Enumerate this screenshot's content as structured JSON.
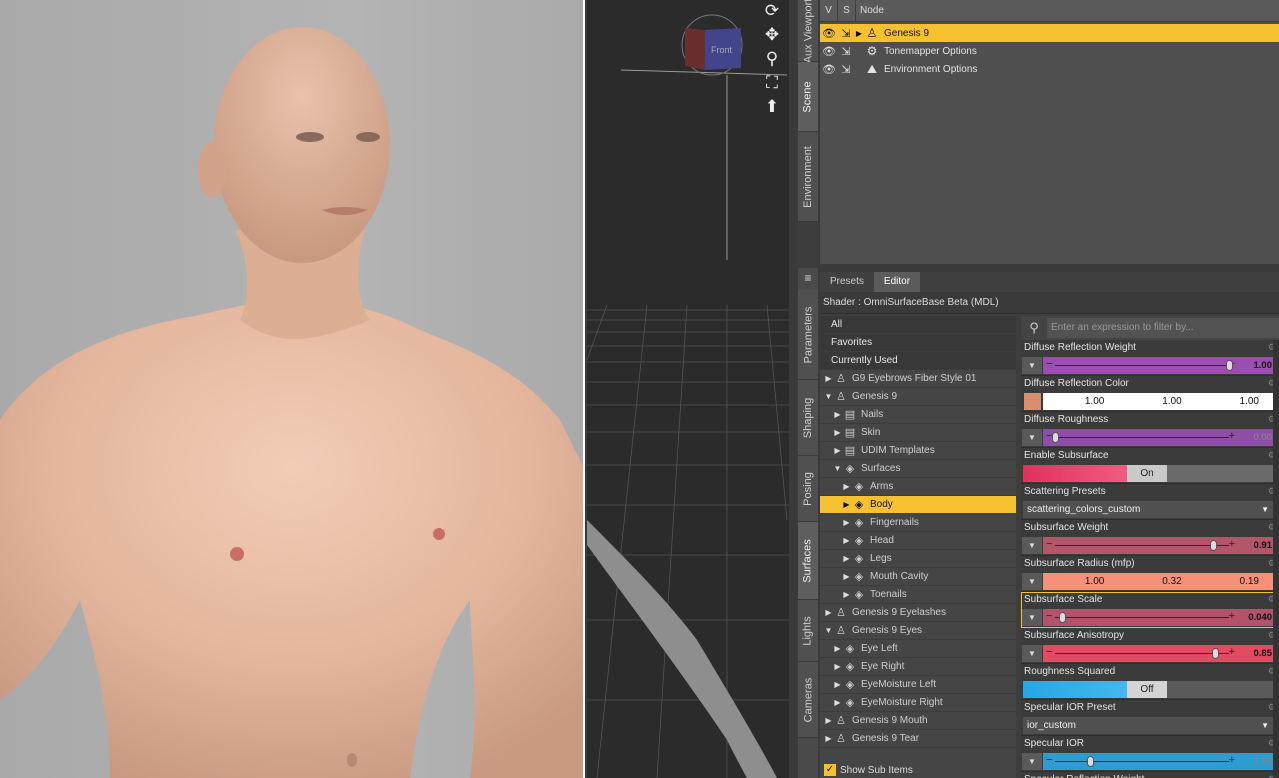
{
  "scene": {
    "columns": [
      "V",
      "S",
      "Node"
    ],
    "rows": [
      {
        "label": "Genesis 9",
        "selected": true
      },
      {
        "label": "Tonemapper Options",
        "selected": false
      },
      {
        "label": "Environment Options",
        "selected": false
      }
    ]
  },
  "side_tabs_top": [
    "Aux Viewport",
    "Scene",
    "Environment"
  ],
  "side_tabs_bottom": [
    "Parameters",
    "Shaping",
    "Posing",
    "Surfaces",
    "Lights",
    "Cameras"
  ],
  "viewport": {
    "cube_label": "Front",
    "tool_icons": [
      "orbit-icon",
      "move-icon",
      "zoom-icon",
      "frame-icon",
      "up-arrow-icon"
    ]
  },
  "surfaces": {
    "tabs": [
      "Presets",
      "Editor"
    ],
    "active_tab": "Editor",
    "shader": "Shader :  OmniSurfaceBase Beta (MDL)",
    "show_sub_items": "Show Sub Items",
    "tree": [
      {
        "label": "All",
        "type": "plain"
      },
      {
        "label": "Favorites",
        "type": "plain"
      },
      {
        "label": "Currently Used",
        "type": "plain"
      },
      {
        "label": "G9 Eyebrows Fiber Style 01",
        "type": "figure",
        "level": 0,
        "open": false
      },
      {
        "label": "Genesis 9",
        "type": "figure",
        "level": 0,
        "open": true
      },
      {
        "label": "Nails",
        "type": "group",
        "level": 1,
        "open": false
      },
      {
        "label": "Skin",
        "type": "group",
        "level": 1,
        "open": false
      },
      {
        "label": "UDIM Templates",
        "type": "group",
        "level": 1,
        "open": false
      },
      {
        "label": "Surfaces",
        "type": "surfaces",
        "level": 1,
        "open": true
      },
      {
        "label": "Arms",
        "type": "mat",
        "level": 2,
        "open": false
      },
      {
        "label": "Body",
        "type": "mat",
        "level": 2,
        "open": false,
        "selected": true
      },
      {
        "label": "Fingernails",
        "type": "mat",
        "level": 2,
        "open": false
      },
      {
        "label": "Head",
        "type": "mat",
        "level": 2,
        "open": false
      },
      {
        "label": "Legs",
        "type": "mat",
        "level": 2,
        "open": false
      },
      {
        "label": "Mouth Cavity",
        "type": "mat",
        "level": 2,
        "open": false
      },
      {
        "label": "Toenails",
        "type": "mat",
        "level": 2,
        "open": false
      },
      {
        "label": "Genesis 9 Eyelashes",
        "type": "figure",
        "level": 0,
        "open": false
      },
      {
        "label": "Genesis 9 Eyes",
        "type": "figure",
        "level": 0,
        "open": true
      },
      {
        "label": "Eye Left",
        "type": "mat",
        "level": 1,
        "open": false
      },
      {
        "label": "Eye Right",
        "type": "mat",
        "level": 1,
        "open": false
      },
      {
        "label": "EyeMoisture Left",
        "type": "mat",
        "level": 1,
        "open": false
      },
      {
        "label": "EyeMoisture Right",
        "type": "mat",
        "level": 1,
        "open": false
      },
      {
        "label": "Genesis 9 Mouth",
        "type": "figure",
        "level": 0,
        "open": false
      },
      {
        "label": "Genesis 9 Tear",
        "type": "figure",
        "level": 0,
        "open": false
      }
    ],
    "filter_placeholder": "Enter an expression to filter by...",
    "props": [
      {
        "label": "Diffuse Reflection Weight",
        "kind": "slider",
        "value": "1.00",
        "frac": 1.0,
        "color": "#9a4fb0",
        "dim": false
      },
      {
        "label": "Diffuse Reflection Color",
        "kind": "color",
        "values": [
          "1.00",
          "1.00",
          "1.00"
        ],
        "swatch": "#d98e6c",
        "bg": "#ffffff"
      },
      {
        "label": "Diffuse Roughness",
        "kind": "slider",
        "value": "0.00",
        "frac": 0.0,
        "color": "#8d4fa6",
        "dim": true
      },
      {
        "label": "Enable Subsurface",
        "kind": "toggle",
        "value": "On",
        "on": true
      },
      {
        "label": "Scattering Presets",
        "kind": "select",
        "value": "scattering_colors_custom"
      },
      {
        "label": "Subsurface Weight",
        "kind": "slider",
        "value": "0.91",
        "frac": 0.91,
        "color": "#b4566a",
        "dim": false
      },
      {
        "label": "Subsurface Radius (mfp)",
        "kind": "color",
        "values": [
          "1.00",
          "0.32",
          "0.19"
        ],
        "swatch": "",
        "bg": "#f6907a"
      },
      {
        "label": "Subsurface Scale",
        "kind": "slider",
        "value": "0.040",
        "frac": 0.04,
        "color": "#b2536a",
        "dim": false,
        "highlight": true
      },
      {
        "label": "Subsurface Anisotropy",
        "kind": "slider",
        "value": "0.85",
        "frac": 0.92,
        "color": "#e34b63",
        "dim": false
      },
      {
        "label": "Roughness Squared",
        "kind": "toggle",
        "value": "Off",
        "on": false
      },
      {
        "label": "Specular IOR Preset",
        "kind": "select",
        "value": "ior_custom"
      },
      {
        "label": "Specular IOR",
        "kind": "slider",
        "value": "1.50",
        "frac": 0.2,
        "color": "#2f9bcf",
        "dim": true
      },
      {
        "label": "Specular Reflection Weight",
        "kind": "slider",
        "value": "",
        "frac": 0.5,
        "color": "#4a8ab0",
        "dim": true
      }
    ]
  }
}
